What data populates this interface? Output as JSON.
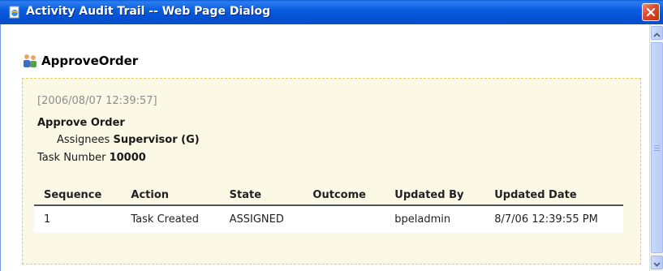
{
  "window": {
    "title": "Activity Audit Trail -- Web Page Dialog",
    "close_symbol": "✕"
  },
  "icons": {
    "app": "ie-page-icon",
    "task": "users-task-icon",
    "close": "close-icon"
  },
  "colors": {
    "titlebar": "#0a5fd8",
    "close": "#e0482b",
    "panel_bg": "#fbf8e5",
    "panel_border": "#e9c86a"
  },
  "task": {
    "title": "ApproveOrder"
  },
  "activity": {
    "timestamp": "[2006/08/07 12:39:57]",
    "name": "Approve Order",
    "assignees_label": "Assignees",
    "assignees_value": "Supervisor (G)",
    "task_number_label": "Task Number",
    "task_number_value": "10000"
  },
  "table": {
    "headers": [
      "Sequence",
      "Action",
      "State",
      "Outcome",
      "Updated By",
      "Updated Date"
    ],
    "rows": [
      [
        "1",
        "Task Created",
        "ASSIGNED",
        "",
        "bpeladmin",
        "8/7/06 12:39:55 PM"
      ]
    ]
  }
}
